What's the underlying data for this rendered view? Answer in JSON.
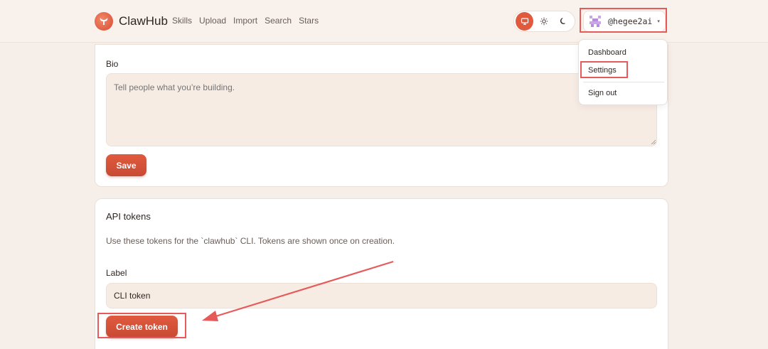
{
  "brand": {
    "name": "ClawHub"
  },
  "nav": [
    {
      "label": "Skills"
    },
    {
      "label": "Upload"
    },
    {
      "label": "Import"
    },
    {
      "label": "Search"
    },
    {
      "label": "Stars"
    }
  ],
  "theme": {
    "options": [
      {
        "icon": "monitor-icon",
        "active": true
      },
      {
        "icon": "sun-icon",
        "active": false
      },
      {
        "icon": "moon-icon",
        "active": false
      }
    ]
  },
  "user": {
    "username": "@hegee2ai",
    "caret": "▾"
  },
  "profile": {
    "bio_label": "Bio",
    "bio_placeholder": "Tell people what you’re building.",
    "bio_value": "",
    "save_label": "Save"
  },
  "tokens": {
    "title": "API tokens",
    "description": "Use these tokens for the `clawhub` CLI. Tokens are shown once on creation.",
    "label_label": "Label",
    "label_value": "CLI token",
    "create_label": "Create token"
  },
  "menu": {
    "items": [
      {
        "label": "Dashboard"
      },
      {
        "label": "Settings"
      },
      {
        "label": "Sign out"
      }
    ]
  },
  "colors": {
    "accent": "#e05a3e",
    "annotation": "#e65a5a",
    "background": "#f6efe9"
  }
}
